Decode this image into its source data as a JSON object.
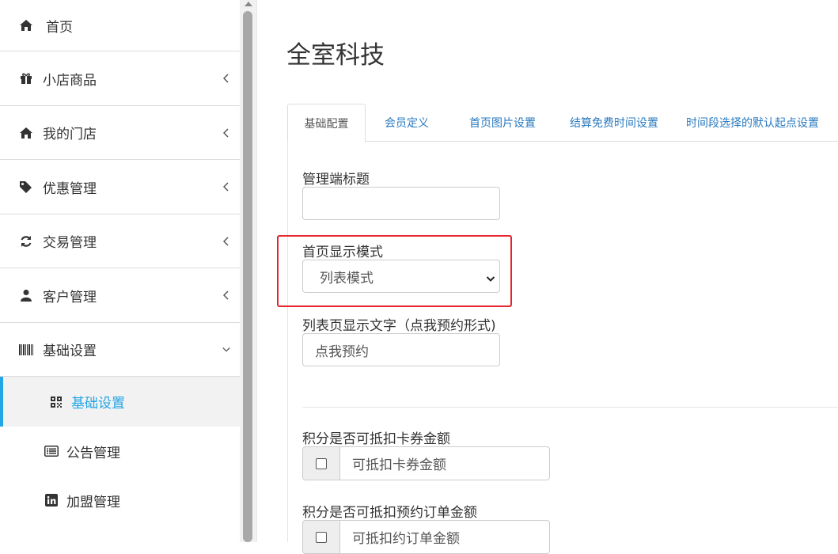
{
  "sidebar": {
    "items": [
      {
        "label": "首页",
        "icon": "home-icon"
      },
      {
        "label": "小店商品",
        "icon": "gift-icon"
      },
      {
        "label": "我的门店",
        "icon": "home-icon"
      },
      {
        "label": "优惠管理",
        "icon": "tags-icon"
      },
      {
        "label": "交易管理",
        "icon": "refresh-icon"
      },
      {
        "label": "客户管理",
        "icon": "user-icon"
      },
      {
        "label": "基础设置",
        "icon": "barcode-icon"
      }
    ],
    "sub_items": [
      {
        "label": "基础设置",
        "icon": "qrcode-icon"
      },
      {
        "label": "公告管理",
        "icon": "list-alt-icon"
      },
      {
        "label": "加盟管理",
        "icon": "linkedin-icon"
      }
    ],
    "accent_color": "#23a6e4"
  },
  "main": {
    "title": "全室科技",
    "tabs": [
      {
        "label": "基础配置"
      },
      {
        "label": "会员定义"
      },
      {
        "label": "首页图片设置"
      },
      {
        "label": "结算免费时间设置"
      },
      {
        "label": "时间段选择的默认起点设置"
      }
    ],
    "form": {
      "admin_title_label": "管理端标题",
      "admin_title_value": "",
      "home_mode_label": "首页显示模式",
      "home_mode_value": "列表模式",
      "list_text_label": "列表页显示文字（点我预约形式)",
      "list_text_value": "点我预约",
      "points_card_label": "积分是否可抵扣卡券金额",
      "points_card_option": "可抵扣卡券金额",
      "points_order_label": "积分是否可抵扣预约订单金额",
      "points_order_option": "可抵扣约订单金额"
    },
    "highlight_color": "#e8242c"
  }
}
